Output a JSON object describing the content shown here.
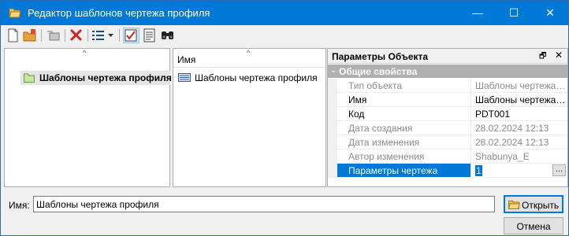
{
  "window": {
    "title": "Редактор шаблонов чертежа профиля",
    "minimize_glyph": "—",
    "maximize_glyph": "☐",
    "close_glyph": "✕"
  },
  "toolbar": {
    "buttons": [
      "new-document-icon",
      "new-folder-icon",
      "move-icon",
      "delete-icon",
      "view-list-icon",
      "dropdown-arrow-icon",
      "checked-box-icon",
      "properties-list-icon",
      "binoculars-icon"
    ]
  },
  "tree": {
    "sort_caret": "^",
    "items": [
      {
        "label": "Шаблоны чертежа профиля",
        "icon": "folder-icon"
      }
    ]
  },
  "list": {
    "header": "Имя",
    "sort_caret": "^",
    "rows": [
      {
        "label": "Шаблоны чертежа профиля",
        "icon": "template-icon"
      }
    ]
  },
  "properties": {
    "title": "Параметры Объекта",
    "pin_glyph": "🗗",
    "close_glyph": "✕",
    "group": {
      "caret": "⌄",
      "label": "Общие свойства"
    },
    "rows": [
      {
        "name": "Тип объекта",
        "value": "Шаблоны чертежа…",
        "disabled": true
      },
      {
        "name": "Имя",
        "value": "Шаблоны чертежа…",
        "disabled": false
      },
      {
        "name": "Код",
        "value": "PDT001",
        "disabled": false
      },
      {
        "name": "Дата создания",
        "value": "28.02.2024 12:13",
        "disabled": true
      },
      {
        "name": "Дата изменения",
        "value": "28.02.2024 12:13",
        "disabled": true
      },
      {
        "name": "Автор изменения",
        "value": "Shabunya_E",
        "disabled": true
      },
      {
        "name": "Параметры чертежа",
        "value": "1",
        "disabled": false,
        "selected": true
      }
    ],
    "ellipsis_label": "..."
  },
  "bottom": {
    "name_label": "Имя:",
    "name_value": "Шаблоны чертежа профиля",
    "open_label": "Открыть",
    "cancel_label": "Отмена"
  },
  "colors": {
    "titlebar": "#0078d7",
    "selection": "#0078d7",
    "group_header": "#b0b0b0",
    "delete_red": "#d42020"
  }
}
